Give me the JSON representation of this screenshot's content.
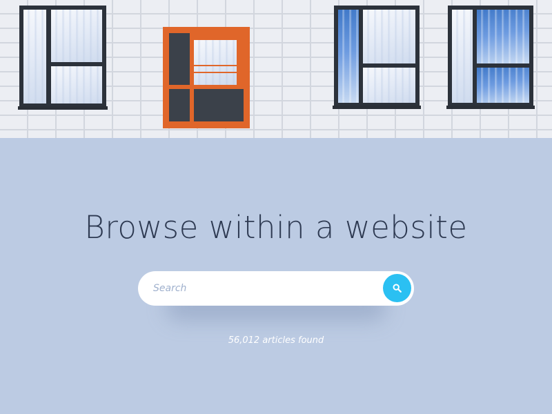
{
  "hero": {
    "image": "building-facade-with-windows"
  },
  "main": {
    "title": "Browse within a website",
    "results_text": "56,012 articles found"
  },
  "search": {
    "placeholder": "Search",
    "value": "",
    "button_icon": "search-icon"
  },
  "colors": {
    "background": "#bccbe3",
    "title": "#2e3a52",
    "accent": "#2bc0f2",
    "window_frame": "#2c323b",
    "window_frame_highlight": "#e0662a"
  }
}
